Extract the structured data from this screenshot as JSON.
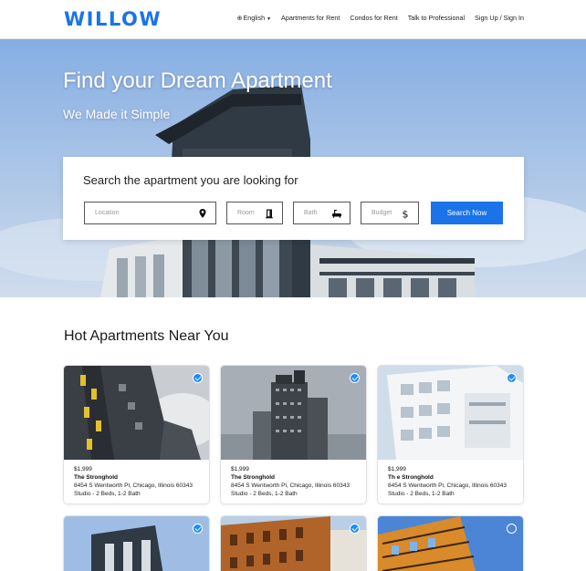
{
  "header": {
    "logo": "WILLOW",
    "nav": {
      "language": "English",
      "apartments": "Apartments for Rent",
      "condos": "Condos for Rent",
      "professional": "Talk to Professional",
      "signin": "Sign Up / Sign In"
    }
  },
  "hero": {
    "title": "Find your Dream Apartment",
    "subtitle": "We Made it Simple"
  },
  "search": {
    "title": "Search the apartment you are looking for",
    "location_placeholder": "Location",
    "room_placeholder": "Room",
    "bath_placeholder": "Bath",
    "budget_placeholder": "Budget",
    "button_label": "Search Now"
  },
  "listings": {
    "section_title": "Hot Apartments Near You",
    "cards": [
      {
        "price": "$1,999",
        "name": "The Stronghold",
        "address": "8454 S Wentworth Pl, Chicago, Illinois 60343",
        "details": "Studio - 2 Beds, 1-2 Bath",
        "verified": true
      },
      {
        "price": "$1,999",
        "name": "The Stronghold",
        "address": "8454 S Wentworth Pl, Chicago, Illinois 60343",
        "details": "Studio - 2 Beds, 1-2 Bath",
        "verified": true
      },
      {
        "price": "$1,999",
        "name": "Th e Stronghold",
        "address": "8454 S Wentworth Pl, Chicago, Illinois 60343",
        "details": "Studio - 2 Beds, 1-2 Bath",
        "verified": true
      },
      {
        "verified": true
      },
      {
        "verified": true
      },
      {
        "verified": false
      }
    ]
  },
  "colors": {
    "accent": "#1a73e8",
    "verified": "#1a8cff"
  },
  "icons": {
    "location": "map-pin-icon",
    "room": "door-icon",
    "bath": "bathtub-icon",
    "budget": "dollar-icon",
    "language": "globe-icon",
    "verified": "check-badge-icon"
  }
}
